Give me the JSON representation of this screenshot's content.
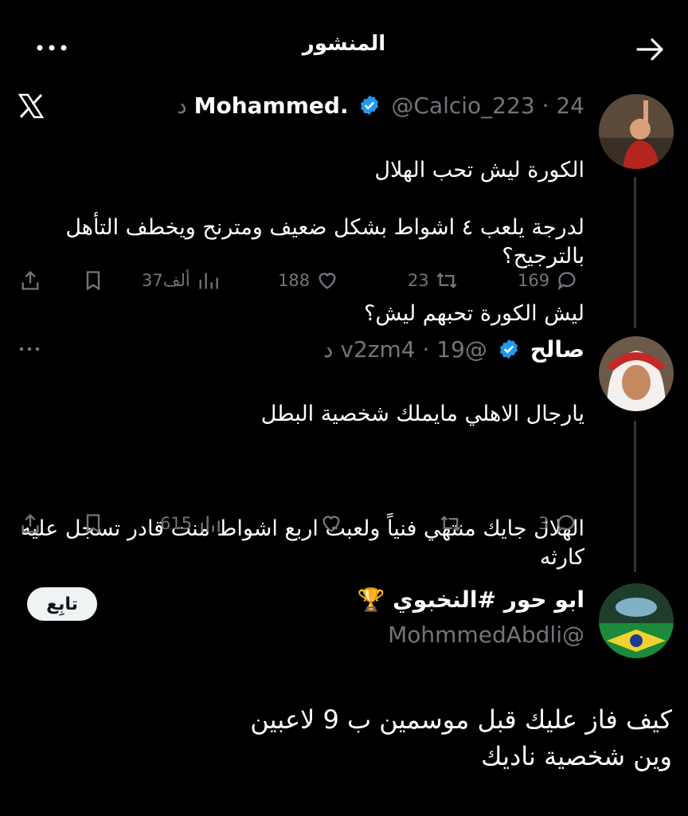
{
  "header": {
    "title": "المنشور"
  },
  "tweet1": {
    "name": "Mohammed.",
    "handle": "@Calcio_223",
    "time": "24 د",
    "lines": [
      "الكورة ليش تحب الهلال",
      "لدرجة يلعب ٤ اشواط بشكل ضعيف ومترنح ويخطف التأهل بالترجيح؟",
      "ليش الكورة تحبهم ليش؟"
    ],
    "replies": "169",
    "retweets": "23",
    "likes": "188",
    "views": "37ألف"
  },
  "tweet2": {
    "name": "صالح",
    "handle": "@v2zm4",
    "time": "19 د",
    "lines": [
      "يارجال الاهلي مايملك شخصية البطل",
      "",
      "الهلال جايك منتهي فنياً ولعبت اربع اشواط منت قادر تسجل عليه كارثه"
    ],
    "replies": "3",
    "retweets": "",
    "likes": "",
    "views": "615"
  },
  "tweet3": {
    "name": "ابو حور #النخبوي 🏆",
    "handle": "@MohmmedAbdli",
    "follow_label": "تابِع",
    "lines": [
      "كيف فاز عليك قبل موسمين ب 9 لاعبين",
      "وين شخصية ناديك"
    ]
  }
}
